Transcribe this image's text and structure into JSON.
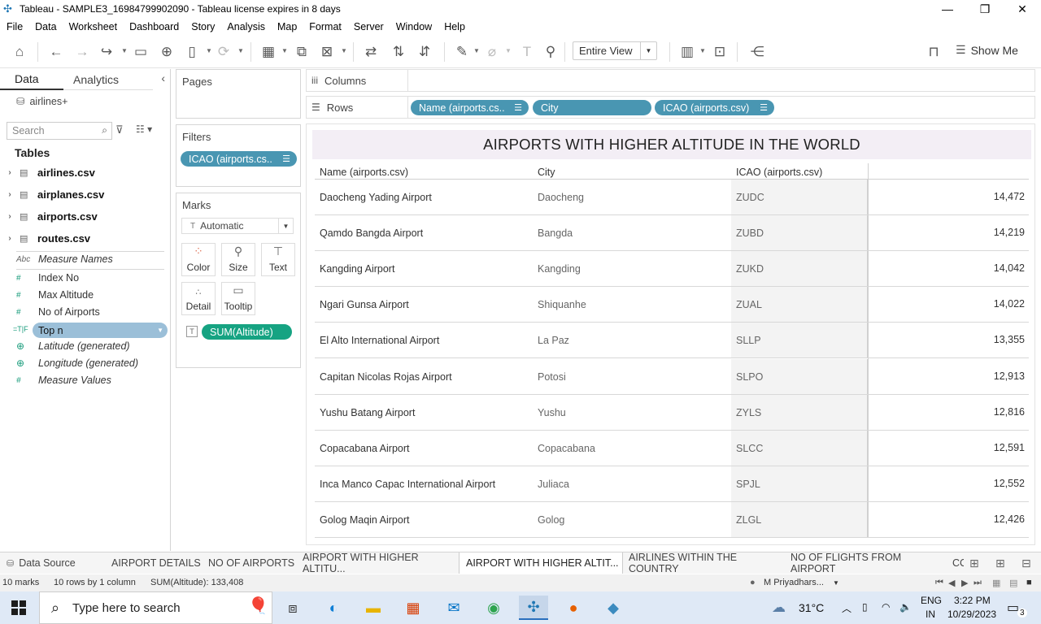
{
  "window": {
    "title": "Tableau - SAMPLE3_16984799902090 - Tableau license expires in 8 days"
  },
  "menu": [
    "File",
    "Data",
    "Worksheet",
    "Dashboard",
    "Story",
    "Analysis",
    "Map",
    "Format",
    "Server",
    "Window",
    "Help"
  ],
  "toolbar": {
    "fit_value": "Entire View",
    "show_me_label": "Show Me"
  },
  "data_pane": {
    "tab_data": "Data",
    "tab_analytics": "Analytics",
    "data_source": "airlines+",
    "search_placeholder": "Search",
    "tables_heading": "Tables",
    "tables": [
      "airlines.csv",
      "airplanes.csv",
      "airports.csv",
      "routes.csv"
    ],
    "fields": [
      {
        "type": "Abc",
        "label": "Measure Names"
      },
      {
        "type": "#",
        "label": "Index No"
      },
      {
        "type": "#",
        "label": "Max Altitude"
      },
      {
        "type": "#",
        "label": "No of Airports"
      },
      {
        "type": "=T|F",
        "label": "Top n"
      },
      {
        "type": "globe",
        "label": "Latitude (generated)"
      },
      {
        "type": "globe",
        "label": "Longitude (generated)"
      },
      {
        "type": "#",
        "label": "Measure Values"
      }
    ]
  },
  "cards": {
    "pages": "Pages",
    "filters": "Filters",
    "filter_pill": "ICAO (airports.cs..",
    "marks": "Marks",
    "mark_type": "Automatic",
    "mark_buttons": [
      "Color",
      "Size",
      "Text",
      "Detail",
      "Tooltip"
    ],
    "mark_pill": "SUM(Altitude)"
  },
  "shelves": {
    "columns_label": "Columns",
    "rows_label": "Rows",
    "rows_pills": [
      "Name (airports.cs..",
      "City",
      "ICAO (airports.csv)"
    ]
  },
  "viz": {
    "title": "AIRPORTS WITH HIGHER ALTITUDE IN THE WORLD",
    "headers": [
      "Name (airports.csv)",
      "City",
      "ICAO (airports.csv)"
    ],
    "rows": [
      {
        "name": "Daocheng Yading Airport",
        "city": "Daocheng",
        "icao": "ZUDC",
        "altitude": "14,472"
      },
      {
        "name": "Qamdo Bangda Airport",
        "city": "Bangda",
        "icao": "ZUBD",
        "altitude": "14,219"
      },
      {
        "name": "Kangding Airport",
        "city": "Kangding",
        "icao": "ZUKD",
        "altitude": "14,042"
      },
      {
        "name": "Ngari Gunsa Airport",
        "city": "Shiquanhe",
        "icao": "ZUAL",
        "altitude": "14,022"
      },
      {
        "name": "El Alto International Airport",
        "city": "La Paz",
        "icao": "SLLP",
        "altitude": "13,355"
      },
      {
        "name": "Capitan Nicolas Rojas Airport",
        "city": "Potosi",
        "icao": "SLPO",
        "altitude": "12,913"
      },
      {
        "name": "Yushu Batang Airport",
        "city": "Yushu",
        "icao": "ZYLS",
        "altitude": "12,816"
      },
      {
        "name": "Copacabana Airport",
        "city": "Copacabana",
        "icao": "SLCC",
        "altitude": "12,591"
      },
      {
        "name": "Inca Manco Capac International Airport",
        "city": "Juliaca",
        "icao": "SPJL",
        "altitude": "12,552"
      },
      {
        "name": "Golog Maqin Airport",
        "city": "Golog",
        "icao": "ZLGL",
        "altitude": "12,426"
      }
    ]
  },
  "sheet_tabs": {
    "data_source": "Data Source",
    "tabs": [
      "AIRPORT DETAILS",
      "NO OF AIRPORTS",
      "AIRPORT WITH HIGHER ALTITU...",
      "AIRPORT WITH HIGHER ALTIT...",
      "AIRLINES WITHIN THE COUNTRY",
      "NO OF FLIGHTS FROM AIRPORT",
      "CC"
    ],
    "active_index": 3
  },
  "status": {
    "marks": "10 marks",
    "dims": "10 rows by 1 column",
    "sum": "SUM(Altitude): 133,408",
    "user": "M Priyadhars..."
  },
  "taskbar": {
    "search_placeholder": "Type here to search",
    "weather": "31°C",
    "lang_top": "ENG",
    "lang_bottom": "IN",
    "time": "3:22 PM",
    "date": "10/29/2023",
    "notifications": "3"
  },
  "colors": {
    "pill_blue": "#4996b2",
    "pill_green": "#16a382",
    "title_band": "#f3eef5"
  }
}
